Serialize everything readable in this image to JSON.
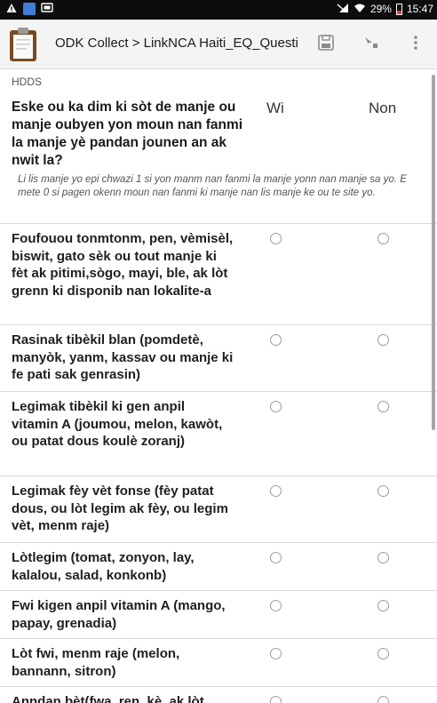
{
  "status_bar": {
    "icons_left": [
      "alert-icon",
      "app-icon",
      "cast-icon"
    ],
    "battery": "29%",
    "battery_level": 0.29,
    "time": "15:47"
  },
  "toolbar": {
    "title": "ODK Collect > LinkNCA Haiti_EQ_Questi...",
    "save_icon": "save-icon",
    "jump_icon": "goto-icon",
    "menu_icon": "overflow-menu-icon"
  },
  "form": {
    "group_label": "HDDS",
    "question": "Eske ou ka dim ki sòt de manje ou manje oubyen yon moun nan fanmi la manje yè pandan jounen an ak nwit la?",
    "columns": [
      "Wi",
      "Non"
    ],
    "hint": "Li lis manje yo epi chwazi 1 si yon manm nan fanmi la manje yonn nan manje sa yo. E mete 0 si pagen okenn moun nan fanmi ki manje nan lis manje ke ou te site yo.",
    "rows": [
      {
        "label": "Foufouou tonmtonm, pen, vèmisèl, biswit, gato sèk ou tout manje ki fèt ak pitimi,sògo, mayi, ble, ak lòt grenn ki disponib nan lokalite-a"
      },
      {
        "label": "Rasinak tibèkil blan (pomdetè, manyòk, yanm, kassav ou manje ki fe pati sak genrasin)"
      },
      {
        "label": "Legimak tibèkil ki gen anpil vitamin A (joumou, melon, kawòt, ou patat dous koulè zoranj)"
      },
      {
        "label": "Legimak fèy vèt fonse (fèy patat dous, ou lòt legim ak fèy, ou legim vèt, menm raje)"
      },
      {
        "label": "Lòtlegim (tomat, zonyon, lay, kalalou, salad, konkonb)"
      },
      {
        "label": "Fwi kigen anpil vitamin A (mango, papay, grenadia)"
      },
      {
        "label": "Lòt fwi, menm raje (melon, bannann, sitron)"
      },
      {
        "label": "Anndan bèt(fwa, ren, kè, ak lòt"
      }
    ]
  }
}
